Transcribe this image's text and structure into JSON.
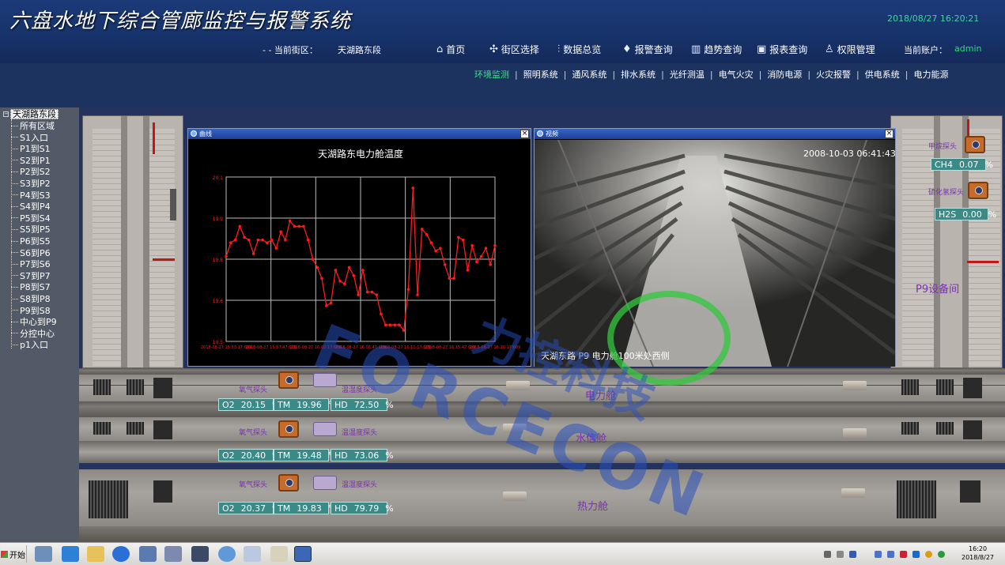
{
  "app": {
    "title": "六盘水地下综合管廊监控与报警系统",
    "datetime": "2018/08/27 16:20:21"
  },
  "header": {
    "street_label": "- - 当前街区：",
    "street_value": "天湖路东段",
    "nav": [
      {
        "label": "首页",
        "icon": "home-icon",
        "glyph": "⌂"
      },
      {
        "label": "街区选择",
        "icon": "street-icon",
        "glyph": "✣"
      },
      {
        "label": "数据总览",
        "icon": "data-overview-icon",
        "glyph": "⫶"
      },
      {
        "label": "报警查询",
        "icon": "alarm-icon",
        "glyph": "♦"
      },
      {
        "label": "趋势查询",
        "icon": "trend-icon",
        "glyph": "▥"
      },
      {
        "label": "报表查询",
        "icon": "report-icon",
        "glyph": "▣"
      },
      {
        "label": "权限管理",
        "icon": "user-icon",
        "glyph": "♙"
      }
    ],
    "account_label": "当前账户：",
    "account_value": "admin"
  },
  "subnav": [
    "环境监测",
    "照明系统",
    "通风系统",
    "排水系统",
    "光纤测温",
    "电气火灾",
    "消防电源",
    "火灾报警",
    "供电系统",
    "电力能源"
  ],
  "tree": {
    "root": "天湖路东段",
    "items": [
      "所有区域",
      "S1入口",
      "P1到S1",
      "S2到P1",
      "P2到S2",
      "S3到P2",
      "P4到S3",
      "S4到P4",
      "P5到S4",
      "S5到P5",
      "P6到S5",
      "S6到P6",
      "P7到S6",
      "S7到P7",
      "P8到S7",
      "S8到P8",
      "P9到S8",
      "中心到P9",
      "分控中心",
      "p1入口"
    ]
  },
  "chart_window": {
    "title": "曲线"
  },
  "video_window": {
    "title": "视频",
    "timestamp": "2008-10-03 06:41:43",
    "caption": "天湖东路 P9 电力舱100米处西侧"
  },
  "chart_data": {
    "type": "line",
    "title": "天湖路东电力舱温度",
    "color": "#ff1a1a",
    "y_ticks": [
      "20.1",
      "19.9",
      "19.8",
      "19.6",
      "19.5"
    ],
    "x_ticks": [
      "2018-08-27 15:53:17:609",
      "2018-08-27 15:57:47:609",
      "2018-08-27 16:02:17:609",
      "2018-08-27 16:06:47:609",
      "2018-08-27 16:11:17:609",
      "2018-08-27 16:15:47:609",
      "2018-08-27 16:20:17:609"
    ],
    "ylim": [
      19.5,
      20.1
    ],
    "values": [
      19.81,
      19.86,
      19.87,
      19.92,
      19.88,
      19.87,
      19.82,
      19.87,
      19.87,
      19.86,
      19.87,
      19.84,
      19.9,
      19.87,
      19.94,
      19.92,
      19.92,
      19.92,
      19.87,
      19.8,
      19.77,
      19.73,
      19.63,
      19.64,
      19.76,
      19.72,
      19.71,
      19.77,
      19.74,
      19.67,
      19.76,
      19.68,
      19.68,
      19.67,
      19.6,
      19.56,
      19.56,
      19.56,
      19.56,
      19.54,
      19.69,
      20.06,
      19.67,
      19.91,
      19.89,
      19.86,
      19.83,
      19.84,
      19.78,
      19.73,
      19.73,
      19.88,
      19.87,
      19.76,
      19.85,
      19.79,
      19.81,
      19.84,
      19.78,
      19.85
    ]
  },
  "cabins": [
    {
      "name": "电力舱",
      "o2": "20.15",
      "tm": "19.96",
      "hd": "72.50"
    },
    {
      "name": "水信舱",
      "o2": "20.40",
      "tm": "19.48",
      "hd": "73.06"
    },
    {
      "name": "热力舱",
      "o2": "20.37",
      "tm": "19.83",
      "hd": "79.79"
    }
  ],
  "probe_labels": {
    "oxygen": "氧气探头",
    "temp_humidity": "温湿度探头"
  },
  "stat_units": {
    "o2_label": "O2",
    "tm_label": "TM",
    "hd_label": "HD",
    "percent": "%",
    "celsius": "℃"
  },
  "right_room": {
    "methane_label": "甲烷探头",
    "h2s_label": "硫化氢探头",
    "ch4_label": "CH4",
    "ch4_value": "0.07",
    "ch4_unit": "%",
    "h2s_gas_label": "H2S",
    "h2s_value": "0.00",
    "h2s_unit": "%",
    "equipment_label": "P9设备间"
  },
  "watermark": {
    "en": "FORCECON",
    "cn": "力控科技"
  },
  "taskbar": {
    "start": "开始",
    "clock_time": "16:20",
    "clock_date": "2018/8/27"
  }
}
